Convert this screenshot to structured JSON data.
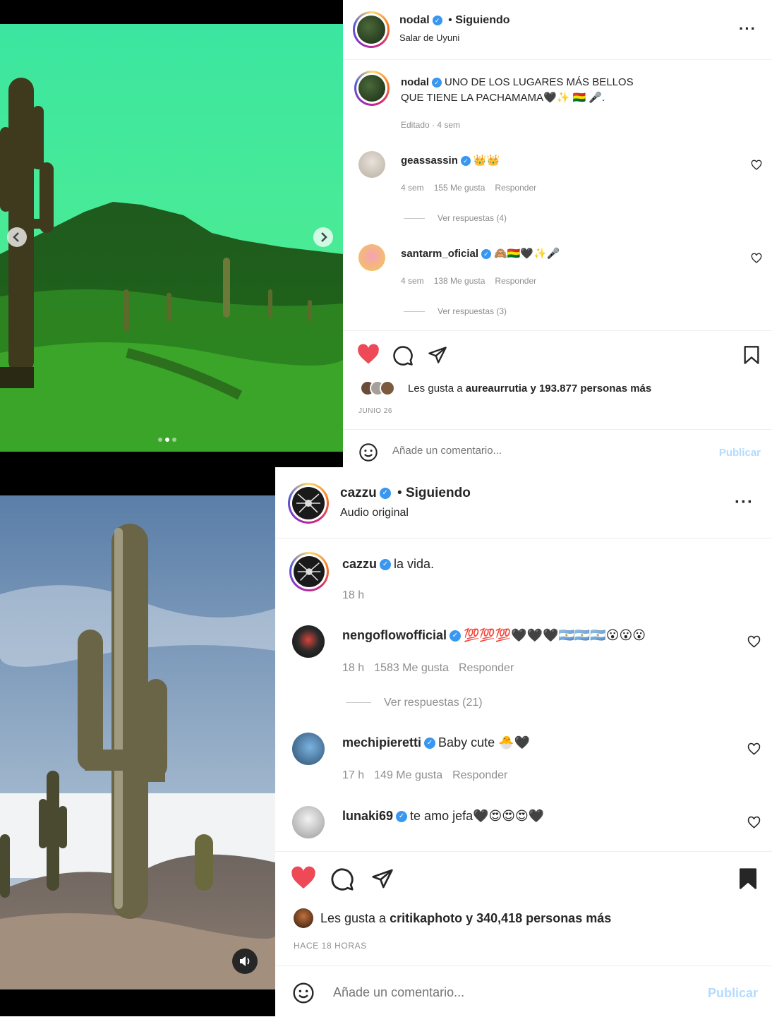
{
  "post1": {
    "username": "nodal",
    "follow_status": "Siguiendo",
    "location": "Salar de Uyuni",
    "caption_user": "nodal",
    "caption_line1": "UNO DE LOS LUGARES MÁS BELLOS",
    "caption_line2": "QUE TIENE LA PACHAMAMA🖤✨ 🇧🇴 🎤.",
    "caption_meta": "Editado · 4 sem",
    "comments": [
      {
        "user": "geassassin",
        "text": "👑👑",
        "time": "4 sem",
        "likes": "155 Me gusta",
        "reply": "Responder",
        "view_replies": "Ver respuestas (4)"
      },
      {
        "user": "santarm_oficial",
        "text": "🙈🇧🇴🖤✨🎤",
        "time": "4 sem",
        "likes": "138 Me gusta",
        "reply": "Responder",
        "view_replies": "Ver respuestas (3)"
      }
    ],
    "likes_text_prefix": "Les gusta a ",
    "likes_user": "aureaurrutia",
    "likes_text_suffix": " y 193.877 personas más",
    "date": "JUNIO 26",
    "comment_placeholder": "Añade un comentario...",
    "publish_label": "Publicar"
  },
  "post2": {
    "username": "cazzu",
    "follow_status": "Siguiendo",
    "subtitle": "Audio original",
    "caption_user": "cazzu",
    "caption_text": "la vida.",
    "caption_meta": "18 h",
    "comments": [
      {
        "user": "nengoflowofficial",
        "text": "💯💯💯🖤🖤🖤🇦🇷🇦🇷🇦🇷😮😮😮",
        "time": "18 h",
        "likes": "1583 Me gusta",
        "reply": "Responder",
        "view_replies": "Ver respuestas (21)"
      },
      {
        "user": "mechipieretti",
        "text": "Baby cute 🐣🖤",
        "time": "17 h",
        "likes": "149 Me gusta",
        "reply": "Responder"
      },
      {
        "user": "lunaki69",
        "text": "te amo jefa🖤😍😍😍🖤"
      }
    ],
    "likes_text_prefix": "Les gusta a ",
    "likes_user": "critikaphoto",
    "likes_text_suffix": " y 340,418 personas más",
    "date": "HACE 18 HORAS",
    "comment_placeholder": "Añade un comentario...",
    "publish_label": "Publicar"
  },
  "colors": {
    "like_red": "#ed4956",
    "verified_blue": "#3897f0",
    "publish_disabled": "#b3dbff",
    "muted_text": "#8e8e8e"
  },
  "icons": {
    "verified": "verified-badge-icon",
    "more": "more-options-icon",
    "heart": "heart-icon",
    "comment": "comment-icon",
    "share": "share-icon",
    "save": "bookmark-icon",
    "emoji": "emoji-icon",
    "audio": "speaker-icon",
    "prev": "chevron-left-icon",
    "next": "chevron-right-icon"
  }
}
